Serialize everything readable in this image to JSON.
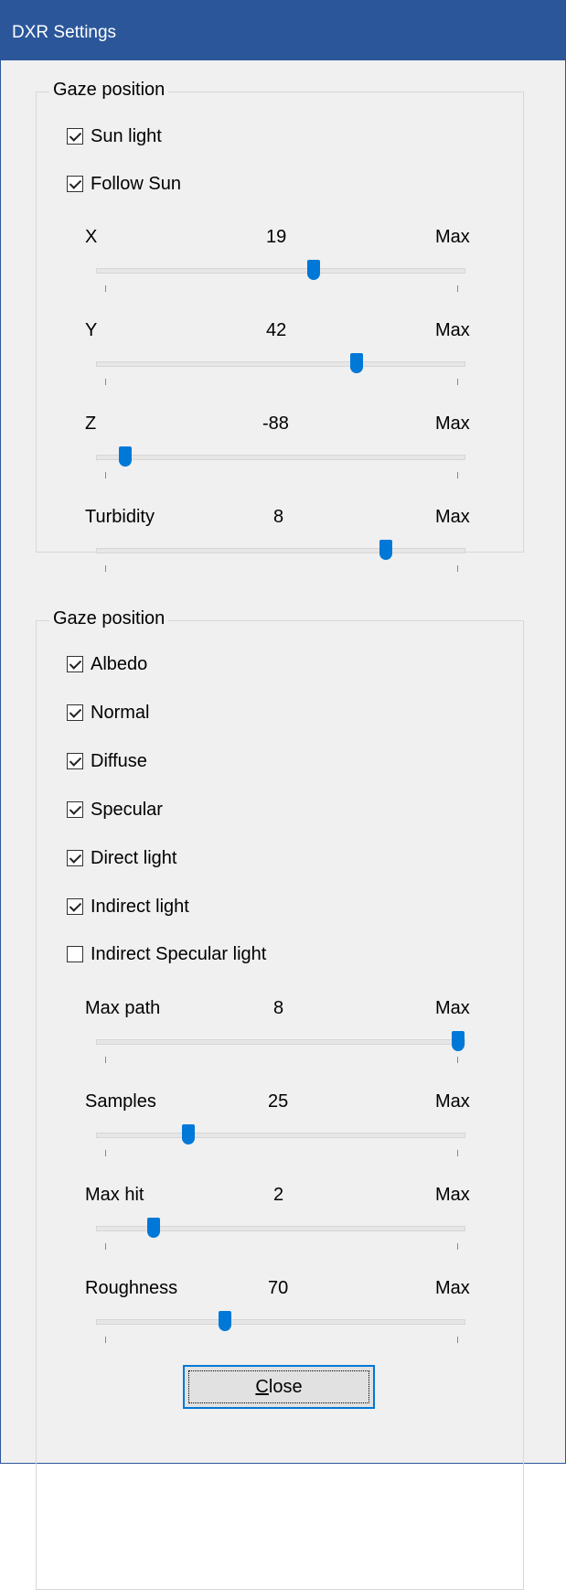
{
  "window": {
    "title": "DXR Settings"
  },
  "group1": {
    "legend": "Gaze position",
    "checkboxes": [
      {
        "label": "Sun light",
        "checked": true
      },
      {
        "label": "Follow Sun",
        "checked": true
      }
    ],
    "sliders": [
      {
        "label": "X",
        "value": "19",
        "max_label": "Max",
        "fraction": 0.59
      },
      {
        "label": "Y",
        "value": "42",
        "max_label": "Max",
        "fraction": 0.705
      },
      {
        "label": "Z",
        "value": "-88",
        "max_label": "Max",
        "fraction": 0.08
      },
      {
        "label": "Turbidity",
        "value": "8",
        "max_label": "Max",
        "fraction": 0.785
      }
    ]
  },
  "group2": {
    "legend": "Gaze position",
    "checkboxes": [
      {
        "label": "Albedo",
        "checked": true
      },
      {
        "label": "Normal",
        "checked": true
      },
      {
        "label": "Diffuse",
        "checked": true
      },
      {
        "label": "Specular",
        "checked": true
      },
      {
        "label": "Direct light",
        "checked": true
      },
      {
        "label": "Indirect light",
        "checked": true
      },
      {
        "label": "Indirect Specular light",
        "checked": false
      }
    ],
    "sliders": [
      {
        "label": "Max path",
        "value": "8",
        "max_label": "Max",
        "fraction": 0.98
      },
      {
        "label": "Samples",
        "value": "25",
        "max_label": "Max",
        "fraction": 0.25
      },
      {
        "label": "Max hit",
        "value": "2",
        "max_label": "Max",
        "fraction": 0.155
      },
      {
        "label": "Roughness",
        "value": "70",
        "max_label": "Max",
        "fraction": 0.35
      }
    ]
  },
  "close_button": {
    "label_underlined": "C",
    "label_rest": "lose"
  }
}
